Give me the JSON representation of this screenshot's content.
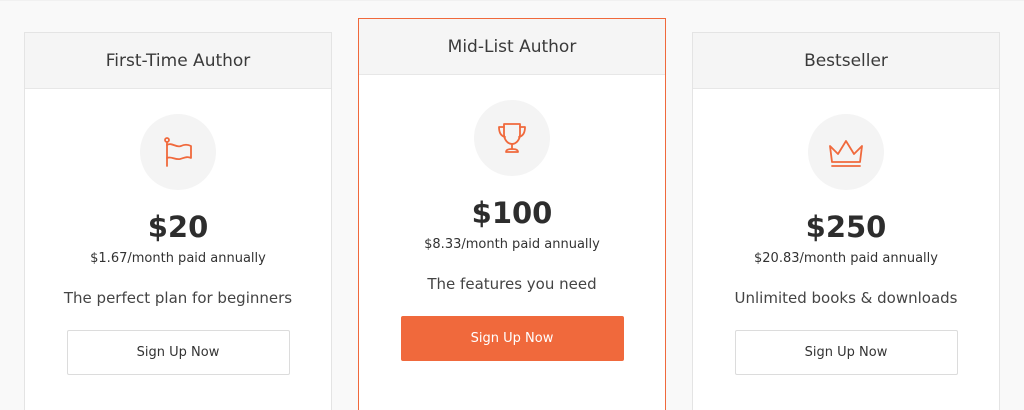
{
  "colors": {
    "accent": "#f0693c",
    "header_bg": "#f5f5f5",
    "icon_circle_bg": "#f4f4f4"
  },
  "plans": [
    {
      "title": "First-Time Author",
      "icon": "flag-icon",
      "price": "$20",
      "per_month": "$1.67/month paid annually",
      "tagline": "The perfect plan for beginners",
      "cta_label": "Sign Up Now",
      "featured": false
    },
    {
      "title": "Mid-List Author",
      "icon": "trophy-icon",
      "price": "$100",
      "per_month": "$8.33/month paid annually",
      "tagline": "The features you need",
      "cta_label": "Sign Up Now",
      "featured": true
    },
    {
      "title": "Bestseller",
      "icon": "crown-icon",
      "price": "$250",
      "per_month": "$20.83/month paid annually",
      "tagline": "Unlimited books & downloads",
      "cta_label": "Sign Up Now",
      "featured": false
    }
  ]
}
